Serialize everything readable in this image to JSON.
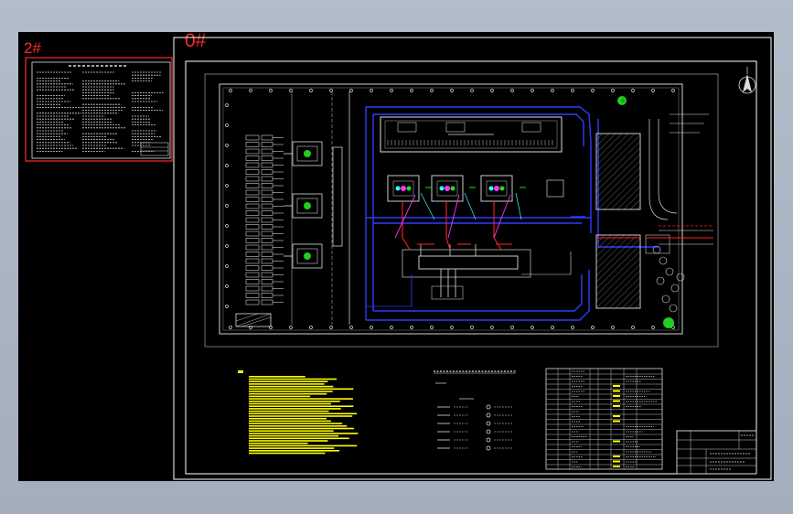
{
  "sheets": {
    "sheet2_label": "2#",
    "sheet0_label": "0#"
  },
  "colors": {
    "background": "#000000",
    "frame": "#ffffff",
    "sheet_label": "#ff2a2a",
    "drawing_line": "#c8c8c8",
    "road": "#2c3cff",
    "note_text": "#ffff00",
    "tree": "#22cc22",
    "cable_red": "#ff2020",
    "cable_green": "#22dd22",
    "cable_magenta": "#ff33ff",
    "cable_cyan": "#33ffff"
  },
  "icons": [
    "north-arrow-icon",
    "tree-icon"
  ]
}
